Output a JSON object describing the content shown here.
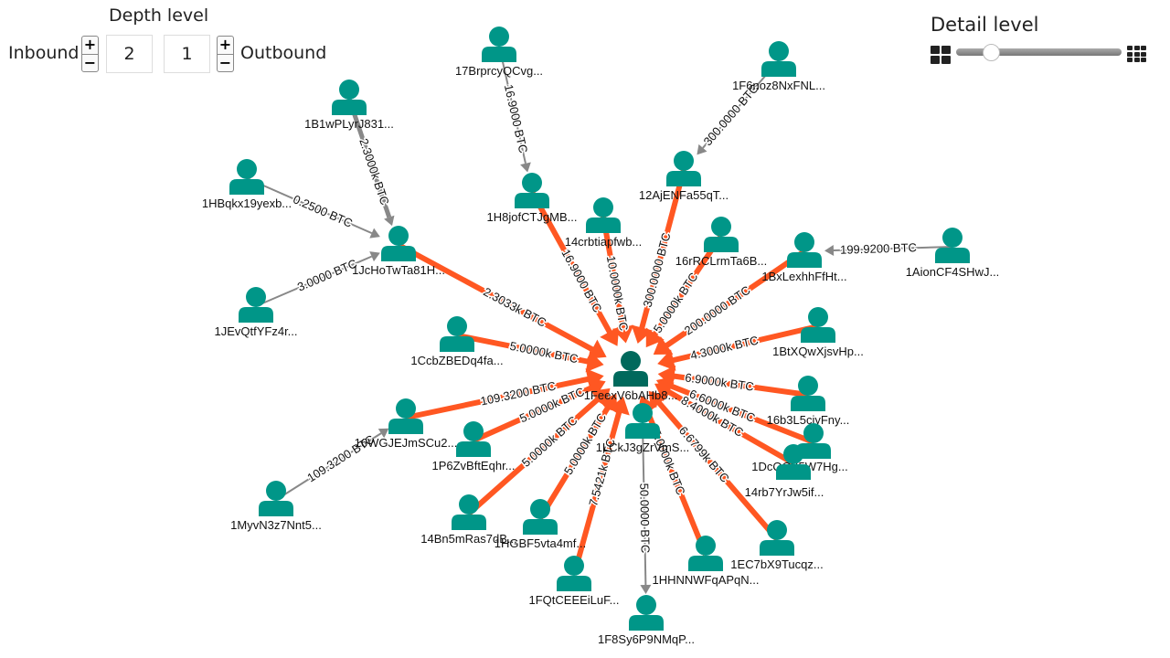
{
  "controls": {
    "depth_title": "Depth level",
    "inbound_label": "Inbound",
    "outbound_label": "Outbound",
    "inbound_value": "2",
    "outbound_value": "1",
    "plus": "+",
    "minus": "−",
    "detail_title": "Detail level",
    "detail_level": 0.17
  },
  "colors": {
    "node": "#009688",
    "center_node": "#00695c",
    "edge_main": "#ff5722",
    "edge_secondary": "#888888"
  },
  "graph": {
    "nodes": [
      {
        "id": 0,
        "label": "1FeexV6bAHb8...",
        "center": true
      },
      {
        "id": 1,
        "label": "17BrprcyQCvg..."
      },
      {
        "id": 2,
        "label": "1H8jofCTJgMB..."
      },
      {
        "id": 3,
        "label": "1B1wPLyrJ831..."
      },
      {
        "id": 4,
        "label": "1HBqkx19yexb..."
      },
      {
        "id": 5,
        "label": "1JcHoTwTa81H..."
      },
      {
        "id": 6,
        "label": "1JEvQtfYFz4r..."
      },
      {
        "id": 7,
        "label": "14crbtiapfwb..."
      },
      {
        "id": 8,
        "label": "12AjENFa55qT..."
      },
      {
        "id": 9,
        "label": "1F6noz8NxFNL..."
      },
      {
        "id": 10,
        "label": "16rRCLrmTa6B..."
      },
      {
        "id": 11,
        "label": "1BxLexhhFfHt..."
      },
      {
        "id": 12,
        "label": "1AionCF4SHwJ..."
      },
      {
        "id": 13,
        "label": "1BtXQwXjsvHp..."
      },
      {
        "id": 14,
        "label": "16b3L5ciyFny..."
      },
      {
        "id": 15,
        "label": "1DcQCB5W7Hg..."
      },
      {
        "id": 16,
        "label": "14rb7YrJw5if..."
      },
      {
        "id": 17,
        "label": "1EC7bX9Tucqz..."
      },
      {
        "id": 18,
        "label": "1HHNNWFqAPqN..."
      },
      {
        "id": 19,
        "label": "1F8Sy6P9NMqP..."
      },
      {
        "id": 20,
        "label": "1LCkJ3gZrVmS..."
      },
      {
        "id": 21,
        "label": "1FQtCEEEiLuF..."
      },
      {
        "id": 22,
        "label": "1HGBF5vta4mf..."
      },
      {
        "id": 23,
        "label": "14Bn5mRas7dB..."
      },
      {
        "id": 24,
        "label": "1P6ZvBftEqhr..."
      },
      {
        "id": 25,
        "label": "16WGJEJmSCu2..."
      },
      {
        "id": 26,
        "label": "1MyvN3z7Nnt5..."
      },
      {
        "id": 27,
        "label": "1CcbZBEDq4fa..."
      }
    ],
    "edges": [
      {
        "from": 1,
        "to": 2,
        "label": "16.9000 BTC",
        "kind": "secondary"
      },
      {
        "from": 2,
        "to": 0,
        "label": "16.9000 BTC",
        "kind": "main"
      },
      {
        "from": 3,
        "to": 5,
        "label": "2.3000k BTC",
        "kind": "secondary"
      },
      {
        "from": 4,
        "to": 5,
        "label": "0.2500 BTC",
        "kind": "secondary"
      },
      {
        "from": 6,
        "to": 5,
        "label": "3.0000 BTC",
        "kind": "secondary"
      },
      {
        "from": 5,
        "to": 0,
        "label": "2.3033k BTC",
        "kind": "main"
      },
      {
        "from": 7,
        "to": 0,
        "label": "10.0000k BTC",
        "kind": "main"
      },
      {
        "from": 9,
        "to": 8,
        "label": "300.0000 BTC",
        "kind": "secondary"
      },
      {
        "from": 8,
        "to": 0,
        "label": "300.0000 BTC",
        "kind": "main"
      },
      {
        "from": 10,
        "to": 0,
        "label": "5.0000k BTC",
        "kind": "main"
      },
      {
        "from": 12,
        "to": 11,
        "label": "199.9200 BTC",
        "kind": "secondary"
      },
      {
        "from": 11,
        "to": 0,
        "label": "200.0000 BTC",
        "kind": "main"
      },
      {
        "from": 13,
        "to": 0,
        "label": "4.3000k BTC",
        "kind": "main"
      },
      {
        "from": 14,
        "to": 0,
        "label": "6.9000k BTC",
        "kind": "main"
      },
      {
        "from": 15,
        "to": 0,
        "label": "6.6000k BTC",
        "kind": "main"
      },
      {
        "from": 16,
        "to": 0,
        "label": "8.4000k BTC",
        "kind": "main"
      },
      {
        "from": 17,
        "to": 0,
        "label": "6.6799k BTC",
        "kind": "main"
      },
      {
        "from": 18,
        "to": 0,
        "label": "5.0000k BTC",
        "kind": "main"
      },
      {
        "from": 20,
        "to": 19,
        "label": "50.0000 BTC",
        "kind": "secondary"
      },
      {
        "from": 21,
        "to": 0,
        "label": "7.5421k BTC",
        "kind": "main"
      },
      {
        "from": 22,
        "to": 0,
        "label": "5.0000k BTC",
        "kind": "main"
      },
      {
        "from": 23,
        "to": 0,
        "label": "5.0000k BTC",
        "kind": "main"
      },
      {
        "from": 24,
        "to": 0,
        "label": "5.0000k BTC",
        "kind": "main"
      },
      {
        "from": 25,
        "to": 0,
        "label": "109.3200 BTC",
        "kind": "main"
      },
      {
        "from": 26,
        "to": 25,
        "label": "109.3200 BTC",
        "kind": "secondary"
      },
      {
        "from": 27,
        "to": 0,
        "label": "5.0000k BTC",
        "kind": "main"
      }
    ]
  }
}
